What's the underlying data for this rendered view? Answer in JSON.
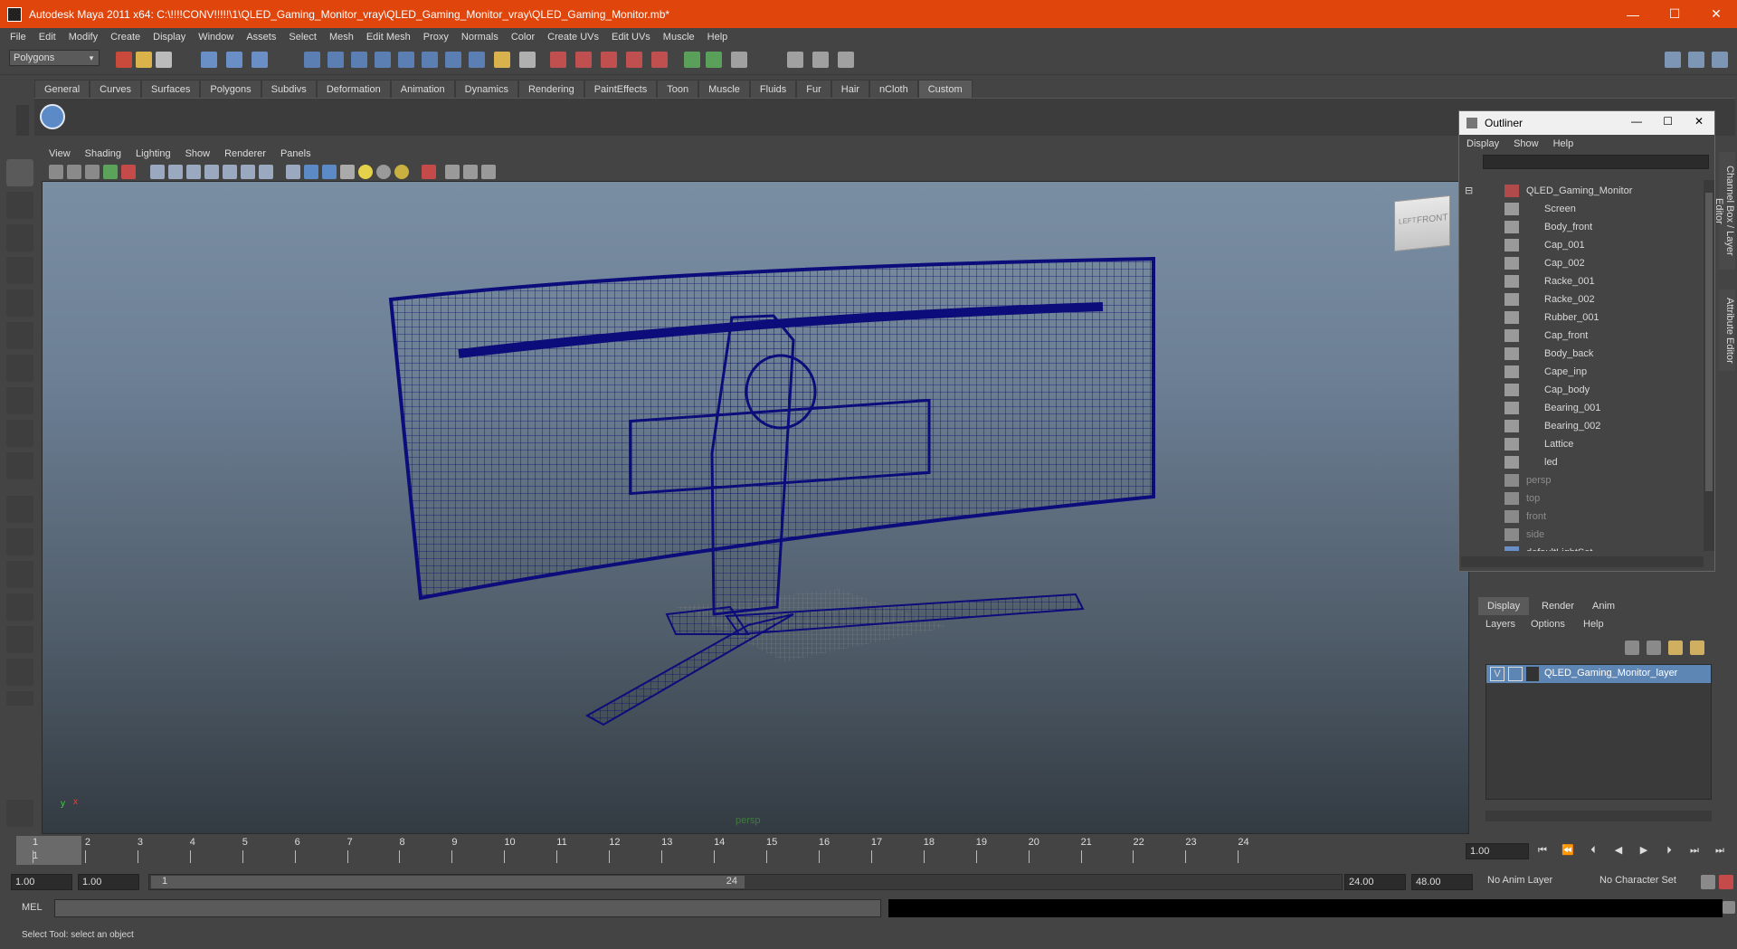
{
  "window": {
    "title": "Autodesk Maya 2011 x64: C:\\!!!!CONV!!!!!\\1\\QLED_Gaming_Monitor_vray\\QLED_Gaming_Monitor_vray\\QLED_Gaming_Monitor.mb*",
    "minimize": "—",
    "maximize": "☐",
    "close": "✕"
  },
  "menubar": [
    "File",
    "Edit",
    "Modify",
    "Create",
    "Display",
    "Window",
    "Assets",
    "Select",
    "Mesh",
    "Edit Mesh",
    "Proxy",
    "Normals",
    "Color",
    "Create UVs",
    "Edit UVs",
    "Muscle",
    "Help"
  ],
  "statusline": {
    "mode": "Polygons",
    "mode_arrow": "▾"
  },
  "shelf": {
    "tabs": [
      "General",
      "Curves",
      "Surfaces",
      "Polygons",
      "Subdivs",
      "Deformation",
      "Animation",
      "Dynamics",
      "Rendering",
      "PaintEffects",
      "Toon",
      "Muscle",
      "Fluids",
      "Fur",
      "Hair",
      "nCloth",
      "Custom"
    ],
    "active": "Custom"
  },
  "viewport": {
    "menu": [
      "View",
      "Shading",
      "Lighting",
      "Show",
      "Renderer",
      "Panels"
    ],
    "camera_label": "persp",
    "viewcube": {
      "left": "LEFT",
      "front": "FRONT"
    },
    "axis": {
      "x": "x",
      "y": "y"
    }
  },
  "outliner": {
    "title": "Outliner",
    "menu": [
      "Display",
      "Show",
      "Help"
    ],
    "filter_value": "",
    "root": "QLED_Gaming_Monitor",
    "children": [
      "Screen",
      "Body_front",
      "Cap_001",
      "Cap_002",
      "Racke_001",
      "Racke_002",
      "Rubber_001",
      "Cap_front",
      "Body_back",
      "Cape_inp",
      "Cap_body",
      "Bearing_001",
      "Bearing_002",
      "Lattice",
      "led"
    ],
    "cameras": [
      "persp",
      "top",
      "front",
      "side"
    ],
    "sets": [
      "defaultLightSet"
    ],
    "collapse_glyph": "⊟"
  },
  "side_tabs": {
    "channel_box": "Channel Box / Layer Editor",
    "attribute_editor": "Attribute Editor"
  },
  "layer_editor": {
    "tabs": [
      "Display",
      "Render",
      "Anim"
    ],
    "active_tab": "Display",
    "menu": [
      "Layers",
      "Options",
      "Help"
    ],
    "layer": {
      "visible": "V",
      "name": "QLED_Gaming_Monitor_layer"
    }
  },
  "timeline": {
    "ticks": [
      "1",
      "2",
      "3",
      "4",
      "5",
      "6",
      "7",
      "8",
      "9",
      "10",
      "11",
      "12",
      "13",
      "14",
      "15",
      "16",
      "17",
      "18",
      "19",
      "20",
      "21",
      "22",
      "23",
      "24"
    ],
    "current_frame": "1",
    "current_time_field": "1.00",
    "playback_buttons": [
      "⏮",
      "⏪",
      "⏴",
      "◀",
      "▶",
      "⏵",
      "⏭",
      "⏭"
    ]
  },
  "range": {
    "start_time": "1.00",
    "playback_start": "1.00",
    "slider_start": "1",
    "slider_end": "24",
    "playback_end": "24.00",
    "end_time": "48.00",
    "anim_layer": "No Anim Layer",
    "character_set": "No Character Set"
  },
  "commandline": {
    "label": "MEL",
    "value": ""
  },
  "helpline": {
    "text": "Select Tool: select an object"
  },
  "colors": {
    "titlebar": "#e0450c",
    "wire": "#0c0c7a",
    "selected_layer": "#5d86b5"
  }
}
